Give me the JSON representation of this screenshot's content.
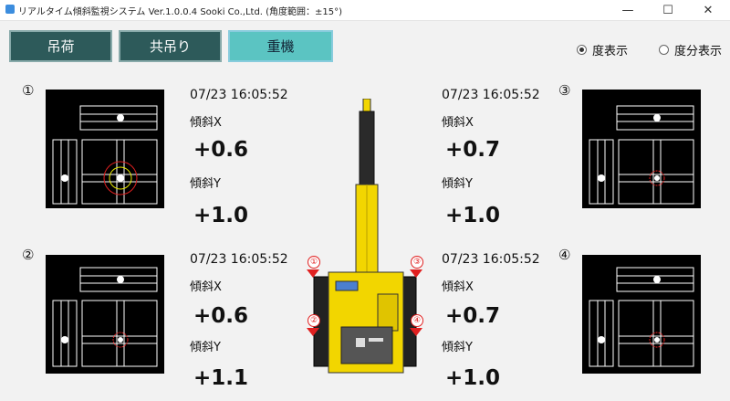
{
  "window": {
    "title": "リアルタイム傾斜監視システム Ver.1.0.0.4 Sooki Co.,Ltd. (角度範囲：±15°)",
    "minimize": "—",
    "maximize": "☐",
    "close": "✕"
  },
  "tabs": [
    {
      "label": "吊荷",
      "active": false
    },
    {
      "label": "共吊り",
      "active": false
    },
    {
      "label": "重機",
      "active": true
    }
  ],
  "display_mode": {
    "options": [
      {
        "label": "度表示",
        "selected": true
      },
      {
        "label": "度分表示",
        "selected": false
      }
    ]
  },
  "sensors": [
    {
      "number": "①",
      "time": "07/23 16:05:52",
      "x_label": "傾斜X",
      "x_value": "+0.6",
      "y_label": "傾斜Y",
      "y_value": "+1.0",
      "bubble_x": 0.6,
      "bubble_y": 1.0
    },
    {
      "number": "②",
      "time": "07/23 16:05:52",
      "x_label": "傾斜X",
      "x_value": "+0.6",
      "y_label": "傾斜Y",
      "y_value": "+1.1",
      "bubble_x": 0.6,
      "bubble_y": 1.1
    },
    {
      "number": "③",
      "time": "07/23 16:05:52",
      "x_label": "傾斜X",
      "x_value": "+0.7",
      "y_label": "傾斜Y",
      "y_value": "+1.0",
      "bubble_x": 0.7,
      "bubble_y": 1.0
    },
    {
      "number": "④",
      "time": "07/23 16:05:52",
      "x_label": "傾斜X",
      "x_value": "+0.7",
      "y_label": "傾斜Y",
      "y_value": "+1.0",
      "bubble_x": 0.7,
      "bubble_y": 1.0
    }
  ],
  "machine_markers": [
    "①",
    "②",
    "③",
    "④"
  ],
  "colors": {
    "tab_bg": "#2d5a5a",
    "tab_active_bg": "#5bc4c2",
    "marker": "#e02020",
    "machine": "#f2d600"
  }
}
